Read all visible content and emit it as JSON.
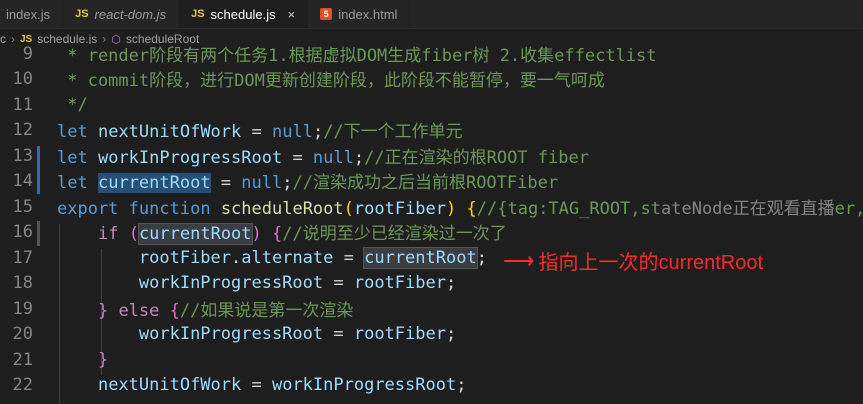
{
  "tabs": [
    {
      "label": "index.js",
      "icon": "",
      "active": false
    },
    {
      "label": "react-dom.js",
      "icon": "JS",
      "active": false
    },
    {
      "label": "schedule.js",
      "icon": "JS",
      "active": true
    },
    {
      "label": "index.html",
      "icon": "5",
      "active": false
    }
  ],
  "close_glyph": "×",
  "breadcrumbs": {
    "folder": "c",
    "file_icon": "JS",
    "file": "schedule.js",
    "symbol": "scheduleRoot"
  },
  "lines": [
    {
      "n": "9"
    },
    {
      "n": "10"
    },
    {
      "n": "11"
    },
    {
      "n": "12"
    },
    {
      "n": "13"
    },
    {
      "n": "14"
    },
    {
      "n": "15"
    },
    {
      "n": "16"
    },
    {
      "n": "17"
    },
    {
      "n": "18"
    },
    {
      "n": "19"
    },
    {
      "n": "20"
    },
    {
      "n": "21"
    },
    {
      "n": "22"
    }
  ],
  "code": {
    "l9": " * render阶段有两个任务1.根据虚拟DOM生成fiber树 2.收集effectlist",
    "l10": " * commit阶段，进行DOM更新创建阶段，此阶段不能暂停，要一气呵成",
    "l11": " */",
    "l12_kw": "let",
    "l12_var": "nextUnitOfWork",
    "l12_op": " = ",
    "l12_null": "null",
    "l12_semi": ";",
    "l12_cm": "//下一个工作单元",
    "l13_kw": "let",
    "l13_var": "workInProgressRoot",
    "l13_op": " = ",
    "l13_null": "null",
    "l13_semi": ";",
    "l13_cm": "//正在渲染的根ROOT fiber",
    "l14_kw": "let",
    "l14_var": "currentRoot",
    "l14_op": " = ",
    "l14_null": "null",
    "l14_semi": ";",
    "l14_cm": "//渲染成功之后当前根ROOTFiber",
    "l15_kw": "export",
    "l15_kw2": "function",
    "l15_fn": "scheduleRoot",
    "l15_param": "rootFiber",
    "l15_cm": "//{tag:TAG_ROOT,st",
    "l15_overlay": "ateNode正在观看直播",
    "l15_tail": "er,p",
    "l16_kw": "if",
    "l16_var": "currentRoot",
    "l16_cm": "//说明至少已经渲染过一次了",
    "l17_var1": "rootFiber",
    "l17_prop": "alternate",
    "l17_var2": "currentRoot",
    "l18_var1": "workInProgressRoot",
    "l18_var2": "rootFiber",
    "l19_kw": "else",
    "l19_cm": "//如果说是第一次渲染",
    "l20_var1": "workInProgressRoot",
    "l20_var2": "rootFiber",
    "l22_var1": "nextUnitOfWork",
    "l22_var2": "workInProgressRoot"
  },
  "annotation": {
    "arrow": "⟶",
    "text": "指向上一次的currentRoot",
    "color": "#ff2a2a"
  },
  "colors": {
    "keyword": "#569cd6",
    "control": "#c586c0",
    "variable": "#9cdcfe",
    "function": "#dcdcaa",
    "comment": "#6a9955",
    "selection": "#264f78"
  }
}
